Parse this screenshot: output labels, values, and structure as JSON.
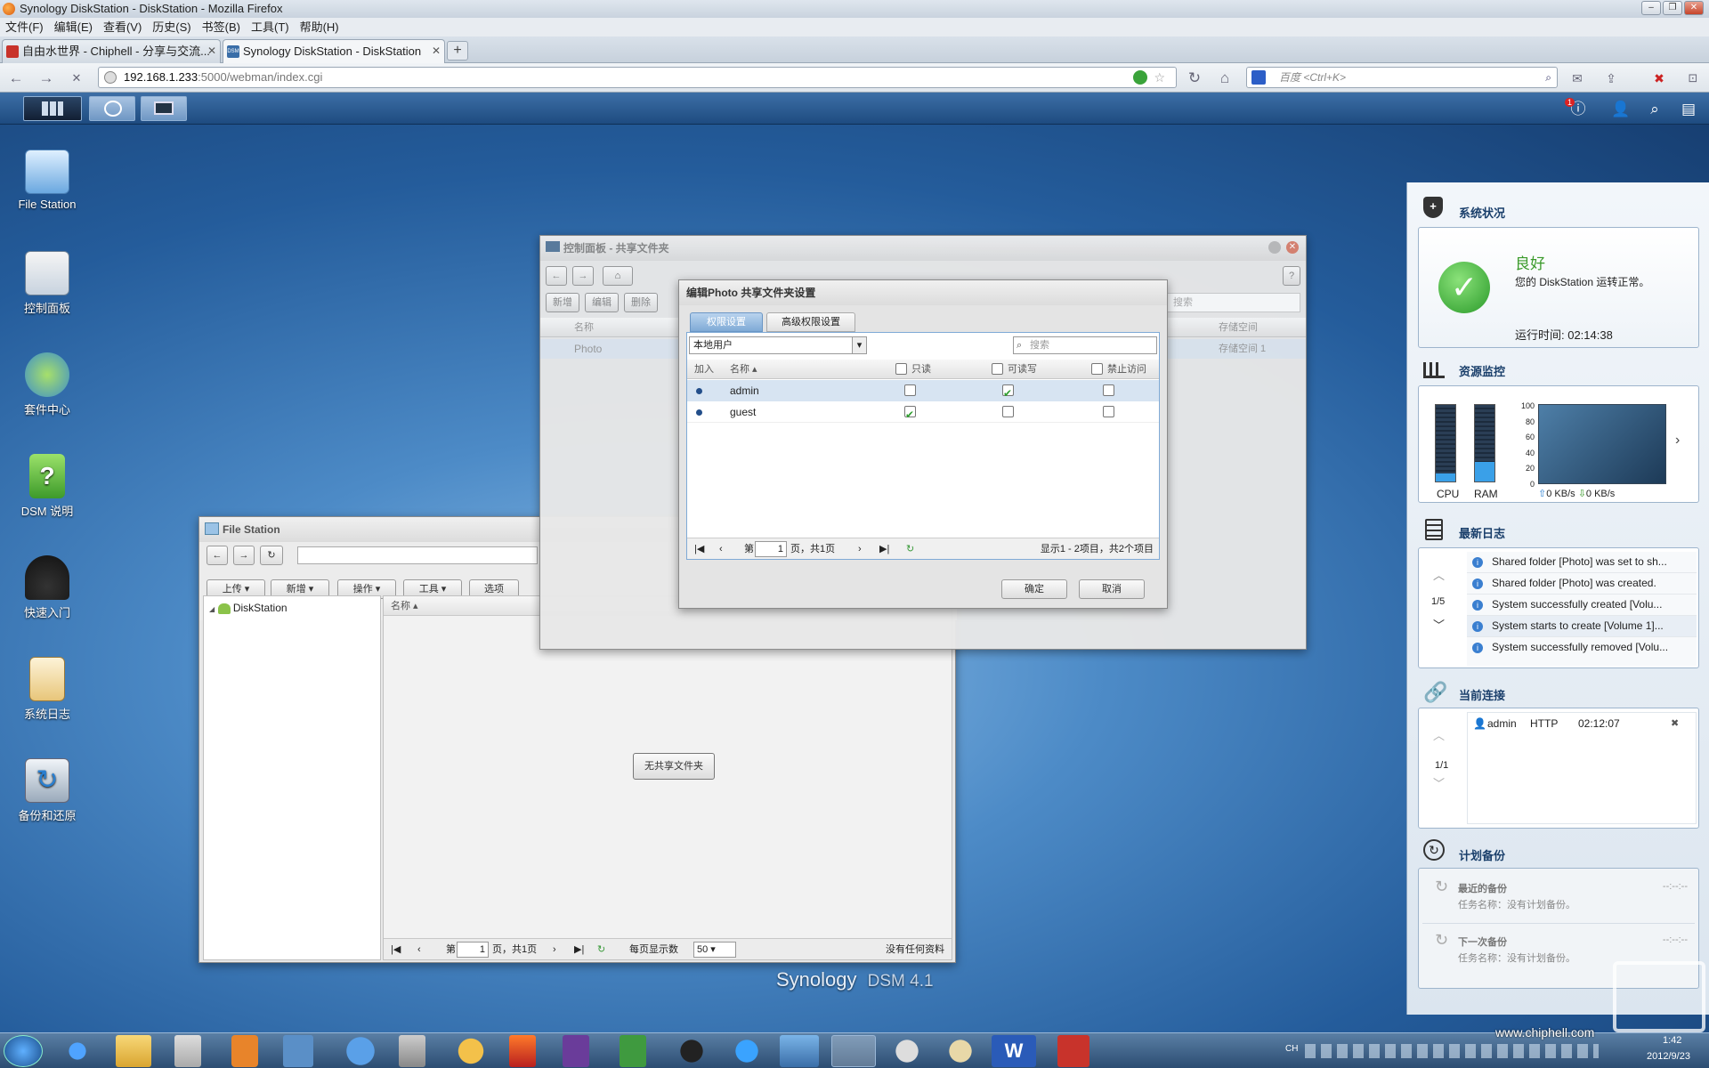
{
  "browser": {
    "window_title": "Synology DiskStation - DiskStation - Mozilla Firefox",
    "menu": [
      "文件(F)",
      "编辑(E)",
      "查看(V)",
      "历史(S)",
      "书签(B)",
      "工具(T)",
      "帮助(H)"
    ],
    "tabs": [
      {
        "label": "自由水世界 - Chiphell - 分享与交流..."
      },
      {
        "label": "Synology DiskStation - DiskStation"
      }
    ],
    "url_host": "192.168.1.233",
    "url_path": ":5000/webman/index.cgi",
    "search_placeholder": "百度 <Ctrl+K>"
  },
  "desktop": {
    "icons": [
      {
        "label": "File Station"
      },
      {
        "label": "控制面板"
      },
      {
        "label": "套件中心"
      },
      {
        "label": "DSM 说明"
      },
      {
        "label": "快速入门"
      },
      {
        "label": "系统日志"
      },
      {
        "label": "备份和还原"
      }
    ],
    "brand": "Synology",
    "brand_version": "DSM 4.1",
    "notification_count": "1"
  },
  "filestation": {
    "title": "File Station",
    "toolbar": [
      "上传",
      "新增",
      "操作",
      "工具",
      "选项"
    ],
    "tree_root": "DiskStation",
    "col_name": "名称",
    "empty_msg": "无共享文件夹",
    "pager": {
      "page_prefix": "第",
      "page": "1",
      "page_suffix": "页，共1页",
      "per_page_label": "每页显示数",
      "per_page": "50",
      "status": "没有任何资料"
    }
  },
  "controlpanel": {
    "title": "控制面板 - 共享文件夹",
    "toolbar": [
      "新增",
      "编辑",
      "删除"
    ],
    "search_placeholder": "搜索",
    "col_name": "名称",
    "col_volume": "存储空间",
    "rows": [
      {
        "name": "Photo",
        "volume": "存储空间 1"
      }
    ]
  },
  "dialog": {
    "title": "编辑Photo 共享文件夹设置",
    "tabs": [
      "权限设置",
      "高级权限设置"
    ],
    "user_type": "本地用户",
    "search_placeholder": "搜索",
    "columns": {
      "join": "加入",
      "name": "名称",
      "readonly": "只读",
      "readwrite": "可读写",
      "deny": "禁止访问"
    },
    "users": [
      {
        "name": "admin",
        "readonly": false,
        "readwrite": true,
        "deny": false
      },
      {
        "name": "guest",
        "readonly": true,
        "readwrite": false,
        "deny": false
      }
    ],
    "pager": {
      "page_prefix": "第",
      "page": "1",
      "page_suffix": "页，共1页",
      "status": "显示1 - 2项目，共2个项目"
    },
    "ok": "确定",
    "cancel": "取消"
  },
  "status_panel": {
    "system": {
      "title": "系统状况",
      "status": "良好",
      "message": "您的 DiskStation 运转正常。",
      "uptime": "运行时间: 02:14:38"
    },
    "resource": {
      "title": "资源监控",
      "cpu_label": "CPU",
      "ram_label": "RAM",
      "axis": [
        "100",
        "80",
        "60",
        "40",
        "20",
        "0"
      ],
      "upload": "0 KB/s",
      "download": "0 KB/s"
    },
    "log": {
      "title": "最新日志",
      "page": "1/5",
      "entries": [
        "Shared folder [Photo] was set to sh...",
        "Shared folder [Photo] was created.",
        "System successfully created [Volu...",
        "System starts to create [Volume 1]...",
        "System successfully removed [Volu..."
      ]
    },
    "connections": {
      "title": "当前连接",
      "page": "1/1",
      "user": "admin",
      "protocol": "HTTP",
      "time": "02:12:07"
    },
    "backup": {
      "title": "计划备份",
      "items": [
        {
          "label": "最近的备份",
          "detail": "任务名称：没有计划备份。",
          "time": "--:--:--"
        },
        {
          "label": "下一次备份",
          "detail": "任务名称：没有计划备份。",
          "time": "--:--:--"
        }
      ]
    }
  },
  "taskbar": {
    "time": "1:42",
    "date": "2012/9/23",
    "lang": "CH",
    "watermark": "www.chiphell.com"
  }
}
